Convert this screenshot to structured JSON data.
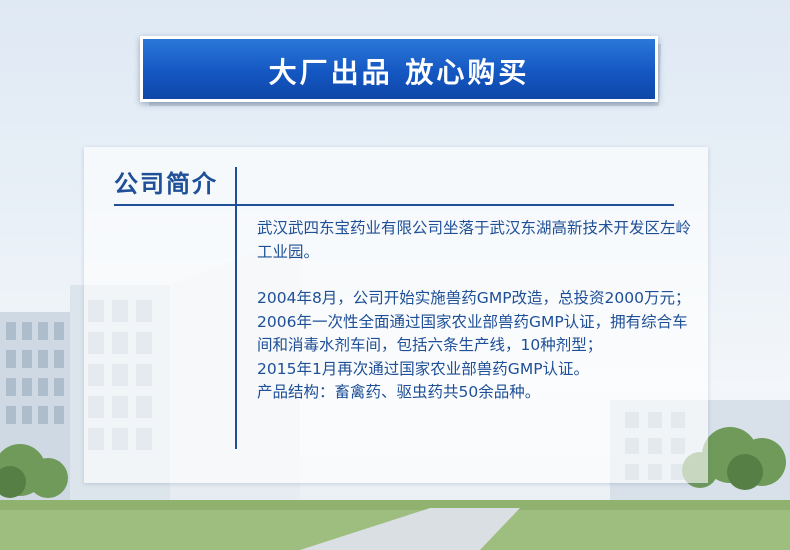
{
  "banner": {
    "title": "大厂出品  放心购买"
  },
  "company_intro": {
    "heading": "公司简介",
    "paragraph1": "武汉武四东宝药业有限公司坐落于武汉东湖高新技术开发区左岭工业园。",
    "lines": [
      "2004年8月，公司开始实施兽药GMP改造，总投资2000万元；",
      "2006年一次性全面通过国家农业部兽药GMP认证，拥有综合车间和消毒水剂车间，包括六条生产线，10种剂型；",
      "2015年1月再次通过国家农业部兽药GMP认证。",
      "产品结构：畜禽药、驱虫药共50余品种。"
    ]
  },
  "colors": {
    "banner_blue": "#1557c2",
    "text_blue": "#1e4f97"
  }
}
